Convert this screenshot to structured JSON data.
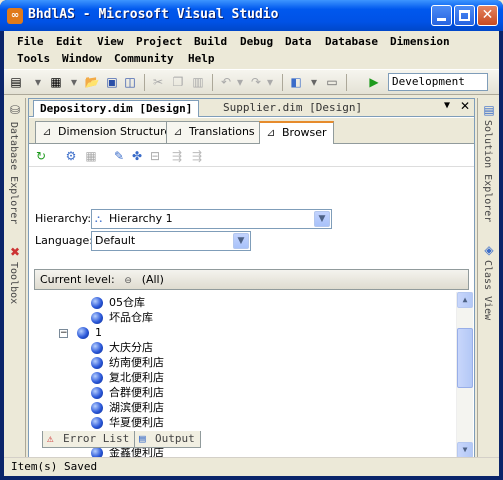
{
  "window": {
    "title": "BhdlAS - Microsoft Visual Studio",
    "app_icon": "visual-studio-icon"
  },
  "menu": {
    "row1": [
      "File",
      "Edit",
      "View",
      "Project",
      "Build",
      "Debug",
      "Data",
      "Database",
      "Dimension"
    ],
    "row2": [
      "Tools",
      "Window",
      "Community",
      "Help"
    ]
  },
  "toolbar": {
    "configuration": "Development"
  },
  "side_left": {
    "tab1": "Database Explorer",
    "tab2": "Toolbox"
  },
  "side_right": {
    "tab1": "Solution Explorer",
    "tab2": "Class View"
  },
  "doc_tabs": [
    {
      "label": "Depository.dim [Design]",
      "active": true
    },
    {
      "label": "Supplier.dim [Design]",
      "active": false
    }
  ],
  "designer_tabs": [
    {
      "label": "Dimension Structure",
      "icon": "dimension-structure-icon"
    },
    {
      "label": "Translations",
      "icon": "translations-icon"
    },
    {
      "label": "Browser",
      "icon": "browser-icon",
      "active": true
    }
  ],
  "browser": {
    "hierarchy_label": "Hierarchy:",
    "hierarchy_value": "Hierarchy 1",
    "language_label": "Language:",
    "language_value": "Default",
    "current_level_label": "Current level:",
    "current_level_value": "(All)"
  },
  "tree": [
    {
      "label": "05仓库",
      "level": 2
    },
    {
      "label": "坏品仓库",
      "level": 2
    },
    {
      "label": "1",
      "level": 1,
      "expanded": true
    },
    {
      "label": "大庆分店",
      "level": 2
    },
    {
      "label": "纺南便利店",
      "level": 2
    },
    {
      "label": "复北便利店",
      "level": 2
    },
    {
      "label": "合群便利店",
      "level": 2
    },
    {
      "label": "湖滨便利店",
      "level": 2
    },
    {
      "label": "华夏便利店",
      "level": 2
    },
    {
      "label": "贾汪分店",
      "level": 2
    },
    {
      "label": "金鑫便利店",
      "level": 2
    }
  ],
  "bottom_tabs": [
    {
      "label": "Error List",
      "icon": "error-list-icon"
    },
    {
      "label": "Output",
      "icon": "output-icon"
    }
  ],
  "status": "Item(s) Saved"
}
